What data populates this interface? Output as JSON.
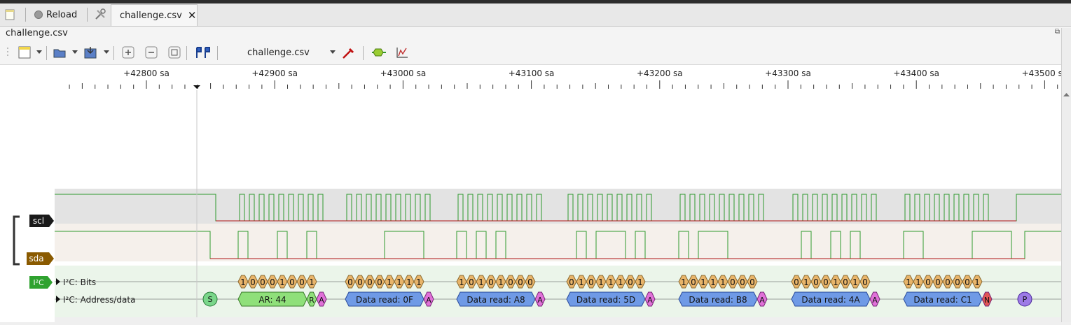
{
  "tabs": {
    "reload_label": "Reload",
    "active_tab_label": "challenge.csv"
  },
  "session_title": "challenge.csv",
  "toolbar": {
    "device_selector_value": "challenge.csv"
  },
  "ruler": {
    "labels": [
      "+42800 sa",
      "+42900 sa",
      "+43000 sa",
      "+43100 sa",
      "+43200 sa",
      "+43300 sa",
      "+43400 sa",
      "+43500 sa"
    ]
  },
  "channels": [
    {
      "name": "scl",
      "color": "#1a1a1a"
    },
    {
      "name": "sda",
      "color": "#8a5a00"
    }
  ],
  "decoder": {
    "badge": "I²C",
    "rows": [
      "I²C: Bits",
      "I²C: Address/data"
    ],
    "bytes": [
      {
        "bits": [
          "1",
          "0",
          "0",
          "0",
          "1",
          "0",
          "0",
          "1"
        ],
        "label": "AR: 44",
        "ack": "A",
        "kind": "address",
        "rw": "R"
      },
      {
        "bits": [
          "0",
          "0",
          "0",
          "0",
          "1",
          "1",
          "1",
          "1"
        ],
        "label": "Data read: 0F",
        "ack": "A",
        "kind": "data"
      },
      {
        "bits": [
          "1",
          "0",
          "1",
          "0",
          "1",
          "0",
          "0",
          "0"
        ],
        "label": "Data read: A8",
        "ack": "A",
        "kind": "data"
      },
      {
        "bits": [
          "0",
          "1",
          "0",
          "1",
          "1",
          "1",
          "0",
          "1"
        ],
        "label": "Data read: 5D",
        "ack": "A",
        "kind": "data"
      },
      {
        "bits": [
          "1",
          "0",
          "1",
          "1",
          "1",
          "0",
          "0",
          "0"
        ],
        "label": "Data read: B8",
        "ack": "A",
        "kind": "data"
      },
      {
        "bits": [
          "0",
          "1",
          "0",
          "0",
          "1",
          "0",
          "1",
          "0"
        ],
        "label": "Data read: 4A",
        "ack": "A",
        "kind": "data"
      },
      {
        "bits": [
          "1",
          "1",
          "0",
          "0",
          "0",
          "0",
          "0",
          "1"
        ],
        "label": "Data read: C1",
        "ack": "N",
        "kind": "data"
      }
    ],
    "start_label": "S",
    "stop_label": "P"
  },
  "colors": {
    "signal_line": "#2e9a2e",
    "signal_low": "#b01515",
    "bit_fill": "#e8b46a",
    "address_fill": "#8fe07a",
    "data_fill": "#6f9ae6",
    "ack_fill": "#e070d8",
    "nack_fill": "#e05555",
    "start_fill": "#7ad68a",
    "stop_fill": "#9d7ae6"
  }
}
